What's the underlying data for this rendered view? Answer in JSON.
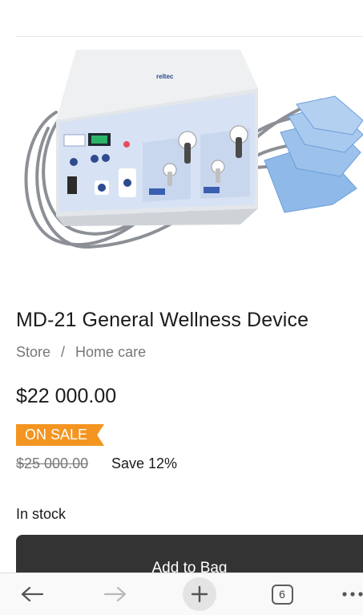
{
  "product": {
    "title": "MD-21 General Wellness Device",
    "brand_on_device": "reltec",
    "breadcrumb": {
      "store": "Store",
      "separator": "/",
      "category": "Home care"
    },
    "price": "$22 000.00",
    "badge": "ON SALE",
    "original_price": "$25 000.00",
    "savings": "Save 12%",
    "stock_status": "In stock",
    "add_to_bag_label": "Add to Bag"
  },
  "browser_bar": {
    "back_icon": "arrow-left-icon",
    "forward_icon": "arrow-right-icon",
    "new_tab_icon": "plus-icon",
    "tab_count": "6",
    "more_icon": "ellipsis-icon"
  },
  "colors": {
    "sale_badge": "#f39520",
    "add_to_bag_bg": "#333333",
    "device_panel": "#d7e3f4",
    "pads": "#8fb9e8"
  }
}
